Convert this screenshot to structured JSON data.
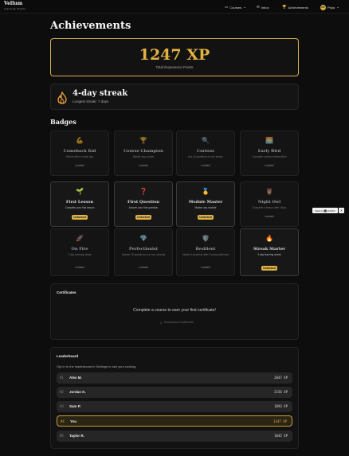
{
  "brand": {
    "name": "Vellum",
    "subtitle": "Learning Studio"
  },
  "nav": {
    "courses": "Courses",
    "inbox": "Inbox",
    "achievements": "Achievements",
    "user_initials": "PR",
    "user_name": "Priya"
  },
  "page": {
    "title": "Achievements"
  },
  "xp": {
    "value": "1247 XP",
    "label": "Total Experience Points"
  },
  "streak": {
    "title": "4-day streak",
    "subtitle": "Longest streak: 7 days"
  },
  "badges": {
    "title": "Badges",
    "items": [
      {
        "icon": "💪",
        "icon_name": "flexed-arm-icon",
        "name": "Comeback Kid",
        "desc": "Return after a stuck day",
        "status": "Locked",
        "unlocked": false
      },
      {
        "icon": "🏆",
        "icon_name": "trophy-icon",
        "name": "Course Champion",
        "desc": "Master any course",
        "status": "Locked",
        "unlocked": false
      },
      {
        "icon": "🔍",
        "icon_name": "magnifier-icon",
        "name": "Curious",
        "desc": "Ask 10 questions in one lesson",
        "status": "Locked",
        "unlocked": false
      },
      {
        "icon": "🌅",
        "icon_name": "sunrise-icon",
        "name": "Early Bird",
        "desc": "Complete a lesson before 8am",
        "status": "Locked",
        "unlocked": false
      },
      {
        "icon": "🌱",
        "icon_name": "seedling-icon",
        "name": "First Lesson",
        "desc": "Complete your first lesson",
        "status": "Unlocked",
        "unlocked": true
      },
      {
        "icon": "❓",
        "icon_name": "question-mark-icon",
        "name": "First Question",
        "desc": "Answer your first question",
        "status": "Unlocked",
        "unlocked": true
      },
      {
        "icon": "🥇",
        "icon_name": "gold-medal-icon",
        "name": "Module Master",
        "desc": "Master any module",
        "status": "Unlocked",
        "unlocked": true
      },
      {
        "icon": "🦉",
        "icon_name": "owl-icon",
        "name": "Night Owl",
        "desc": "Complete a lesson after 10pm",
        "status": "Locked",
        "unlocked": false
      },
      {
        "icon": "🚀",
        "icon_name": "rocket-icon",
        "name": "On Fire",
        "desc": "7-day learning streak",
        "status": "Locked",
        "unlocked": false
      },
      {
        "icon": "💎",
        "icon_name": "gem-icon",
        "name": "Perfectionist",
        "desc": "Answer 10 questions in a row correctly",
        "status": "Locked",
        "unlocked": false
      },
      {
        "icon": "🛡️",
        "icon_name": "shield-icon",
        "name": "Resilient",
        "desc": "Master a question after 3 wrong attempts",
        "status": "Locked",
        "unlocked": false
      },
      {
        "icon": "🔥",
        "icon_name": "flame-icon",
        "name": "Streak Starter",
        "desc": "3-day learning streak",
        "status": "Unlocked",
        "unlocked": true
      }
    ]
  },
  "certificates": {
    "title": "Certificates",
    "message": "Complete a course to earn your first certificate!",
    "download_label": "Download Certificate"
  },
  "leaderboard": {
    "title": "Leaderboard",
    "hint": "Opt in to the leaderboard in Settings to see your ranking.",
    "rows": [
      {
        "rank": "#1",
        "name": "Alex M.",
        "xp": "2847 XP",
        "me": false
      },
      {
        "rank": "#2",
        "name": "Jordan K.",
        "xp": "2156 XP",
        "me": false
      },
      {
        "rank": "#3",
        "name": "Sam P.",
        "xp": "1893 XP",
        "me": false
      },
      {
        "rank": "#4",
        "name": "You",
        "xp": "1247 XP",
        "me": true
      },
      {
        "rank": "#5",
        "name": "Taylor R.",
        "xp": "1045 XP",
        "me": false
      }
    ]
  },
  "made_with": "Made by ⬛HUMAN",
  "colors": {
    "accent": "#e0b445",
    "background": "#0d0d0d",
    "card": "#141414"
  }
}
